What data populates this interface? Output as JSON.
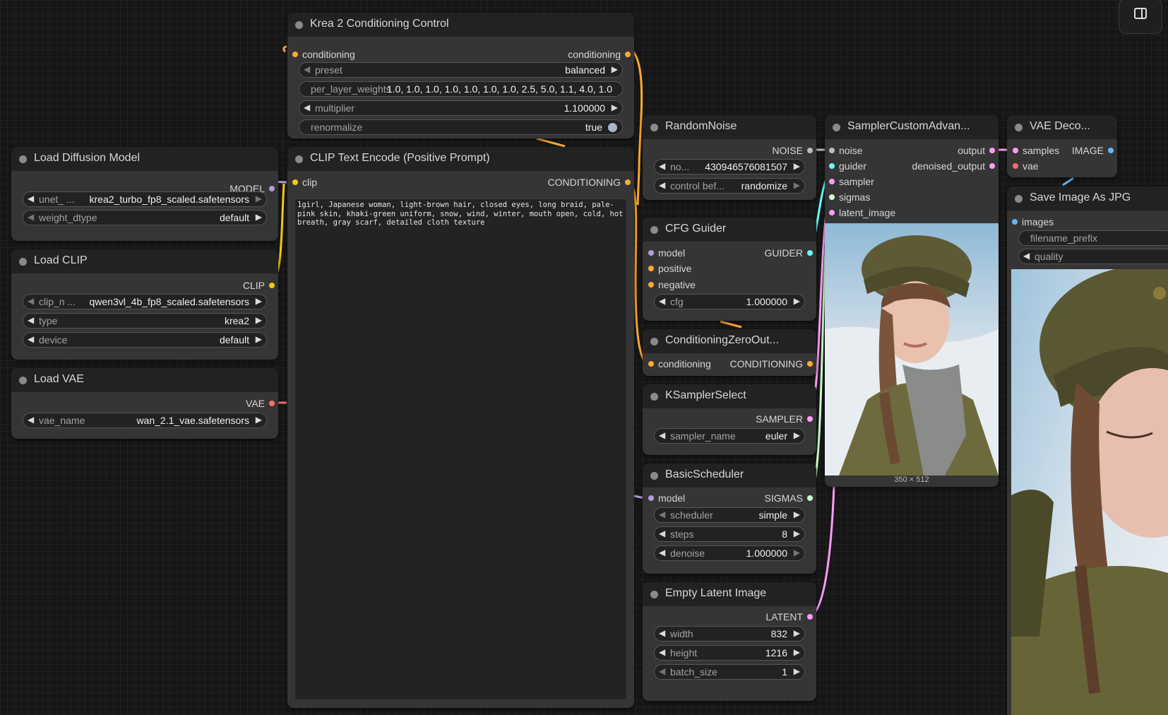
{
  "colors": {
    "clip": "#f6c90e",
    "model": "#b39ddb",
    "vae": "#ff6e6e",
    "conditioning": "#ffa931",
    "noise": "#bbbbbb",
    "guider": "#66ffff",
    "sampler": "#ff9cf9",
    "sigmas": "#cdffcd",
    "latent": "#ff9cf9",
    "image": "#64b5f6"
  },
  "nodes": {
    "krea": {
      "title": "Krea 2 Conditioning Control",
      "in_conditioning": "conditioning",
      "out_conditioning": "conditioning",
      "preset": {
        "name": "preset",
        "value": "balanced"
      },
      "per_layer_weights": {
        "name": "per_layer_weights",
        "value": "1.0, 1.0, 1.0, 1.0, 1.0, 1.0, 1.0, 2.5, 5.0, 1.1, 4.0, 1.0"
      },
      "multiplier": {
        "name": "multiplier",
        "value": "1.100000"
      },
      "renormalize": {
        "name": "renormalize",
        "value": "true"
      }
    },
    "load_diffusion": {
      "title": "Load Diffusion Model",
      "out": "MODEL",
      "unet": {
        "name": "unet_ ...",
        "value": "krea2_turbo_fp8_scaled.safetensors"
      },
      "weight_dtype": {
        "name": "weight_dtype",
        "value": "default"
      }
    },
    "load_clip": {
      "title": "Load CLIP",
      "out": "CLIP",
      "clip_name": {
        "name": "clip_n ...",
        "value": "qwen3vl_4b_fp8_scaled.safetensors"
      },
      "type": {
        "name": "type",
        "value": "krea2"
      },
      "device": {
        "name": "device",
        "value": "default"
      }
    },
    "load_vae": {
      "title": "Load VAE",
      "out": "VAE",
      "vae_name": {
        "name": "vae_name",
        "value": "wan_2.1_vae.safetensors"
      }
    },
    "clip_text": {
      "title": "CLIP Text Encode (Positive Prompt)",
      "in": "clip",
      "out": "CONDITIONING",
      "text": "1girl, Japanese woman, light-brown hair, closed eyes, long braid, pale-pink skin, khaki-green uniform, snow, wind, winter, mouth open, cold, hot breath, gray scarf, detailed cloth texture"
    },
    "random_noise": {
      "title": "RandomNoise",
      "out": "NOISE",
      "noise_seed": {
        "name": "no...",
        "value": "430946576081507"
      },
      "control": {
        "name": "control bef...",
        "value": "randomize"
      }
    },
    "cfg_guider": {
      "title": "CFG Guider",
      "in_model": "model",
      "in_positive": "positive",
      "in_negative": "negative",
      "out": "GUIDER",
      "cfg": {
        "name": "cfg",
        "value": "1.000000"
      }
    },
    "cond_zero": {
      "title": "ConditioningZeroOut...",
      "in": "conditioning",
      "out": "CONDITIONING"
    },
    "ksampler_select": {
      "title": "KSamplerSelect",
      "out": "SAMPLER",
      "sampler_name": {
        "name": "sampler_name",
        "value": "euler"
      }
    },
    "basic_scheduler": {
      "title": "BasicScheduler",
      "in": "model",
      "out": "SIGMAS",
      "scheduler": {
        "name": "scheduler",
        "value": "simple"
      },
      "steps": {
        "name": "steps",
        "value": "8"
      },
      "denoise": {
        "name": "denoise",
        "value": "1.000000"
      }
    },
    "empty_latent": {
      "title": "Empty Latent Image",
      "out": "LATENT",
      "width": {
        "name": "width",
        "value": "832"
      },
      "height": {
        "name": "height",
        "value": "1216"
      },
      "batch_size": {
        "name": "batch_size",
        "value": "1"
      }
    },
    "sampler_custom": {
      "title": "SamplerCustomAdvan...",
      "in_noise": "noise",
      "in_guider": "guider",
      "in_sampler": "sampler",
      "in_sigmas": "sigmas",
      "in_latent": "latent_image",
      "out_output": "output",
      "out_denoised": "denoised_output",
      "preview_size": "350 × 512"
    },
    "vae_decode": {
      "title": "VAE Deco...",
      "in_samples": "samples",
      "in_vae": "vae",
      "out": "IMAGE"
    },
    "save_image": {
      "title": "Save Image As JPG",
      "in": "images",
      "filename_prefix": {
        "name": "filename_prefix"
      },
      "quality": {
        "name": "quality"
      }
    }
  },
  "arrows": {
    "left": "◀",
    "right": "▶"
  }
}
